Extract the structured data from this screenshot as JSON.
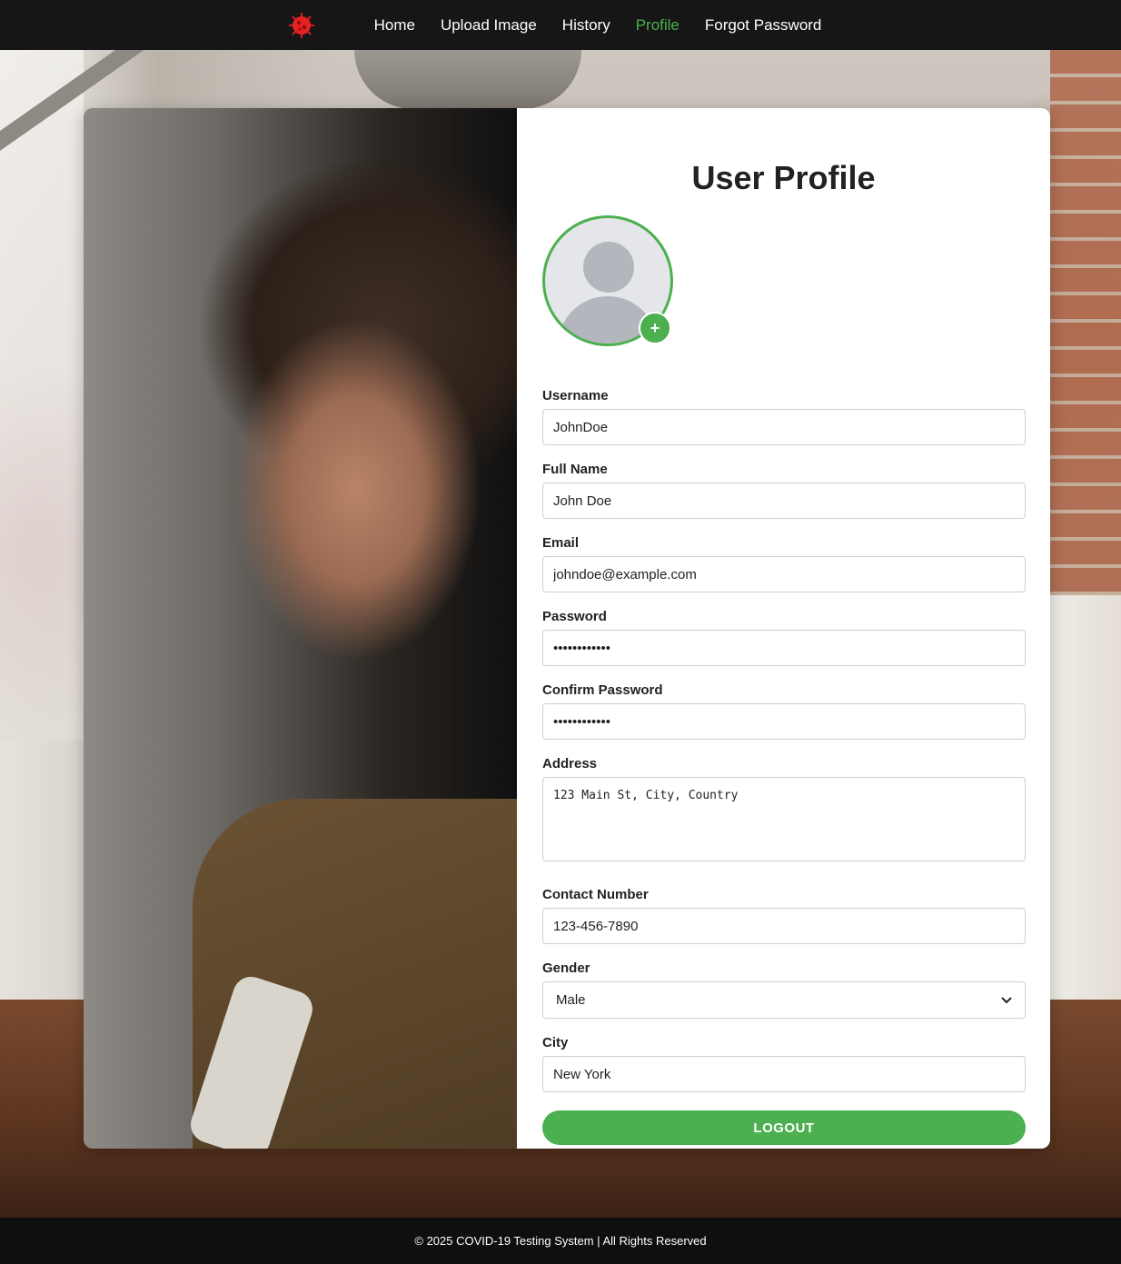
{
  "nav": {
    "logo_icon": "virus-icon",
    "links": [
      {
        "label": "Home",
        "active": false
      },
      {
        "label": "Upload Image",
        "active": false
      },
      {
        "label": "History",
        "active": false
      },
      {
        "label": "Profile",
        "active": true
      },
      {
        "label": "Forgot Password",
        "active": false
      }
    ]
  },
  "profile": {
    "title": "User Profile",
    "avatar_add_icon": "plus-icon",
    "fields": {
      "username": {
        "label": "Username",
        "value": "JohnDoe"
      },
      "full_name": {
        "label": "Full Name",
        "value": "John Doe"
      },
      "email": {
        "label": "Email",
        "value": "johndoe@example.com"
      },
      "password": {
        "label": "Password",
        "value": "••••••••••••"
      },
      "confirm_password": {
        "label": "Confirm Password",
        "value": "••••••••••••"
      },
      "address": {
        "label": "Address",
        "value": "123 Main St, City, Country"
      },
      "contact_number": {
        "label": "Contact Number",
        "value": "123-456-7890"
      },
      "gender": {
        "label": "Gender",
        "value": "Male"
      },
      "city": {
        "label": "City",
        "value": "New York"
      }
    },
    "logout_label": "LOGOUT"
  },
  "footer": {
    "text": "© 2025 COVID-19 Testing System | All Rights Reserved"
  },
  "colors": {
    "accent": "#4caf50",
    "navbar_bg": "#161616",
    "footer_bg": "#0f0f0f"
  }
}
